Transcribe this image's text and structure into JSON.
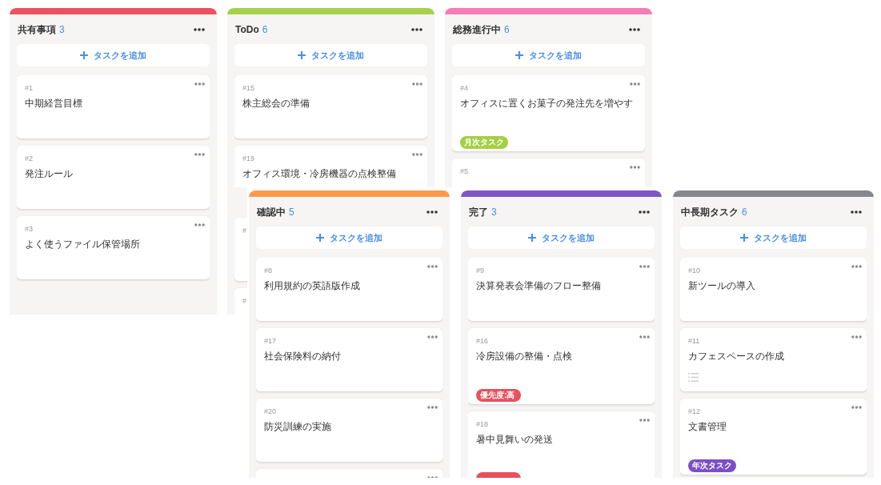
{
  "panels": [
    {
      "columns": [
        {
          "title": "共有事項",
          "count": "3",
          "color": "#ef4f5f",
          "add_label": "タスクを追加",
          "cards": [
            {
              "id": "#1",
              "title": "中期経営目標",
              "has_description": false,
              "menu": true
            },
            {
              "id": "#2",
              "title": "発注ルール",
              "has_description": false,
              "menu": true
            },
            {
              "id": "#3",
              "title": "よく使うファイル保管場所",
              "has_description": false,
              "menu": true
            }
          ]
        },
        {
          "title": "ToDo",
          "count": "6",
          "color": "#a6d24b",
          "add_label": "タスクを追加",
          "cards": [
            {
              "id": "#15",
              "title": "株主総会の準備",
              "has_description": false,
              "menu": true
            },
            {
              "id": "#19",
              "title": "オフィス環境・冷房機器の点検整備",
              "has_description": false,
              "menu": true
            },
            {
              "id": "#"
            },
            {
              "id": "#"
            }
          ]
        },
        {
          "title": "総務進行中",
          "count": "6",
          "color": "#f67cb4",
          "add_label": "タスクを追加",
          "cards": [
            {
              "id": "#4",
              "title": "オフィスに置くお菓子の発注先を増やす",
              "has_description": false,
              "menu": true,
              "tags": [
                {
                  "label": "月次タスク",
                  "color": "#a5cf45"
                }
              ]
            },
            {
              "id": "#5",
              "menu": true
            }
          ]
        }
      ]
    },
    {
      "columns": [
        {
          "title": "確認中",
          "count": "5",
          "color": "#ff9a4b",
          "add_label": "タスクを追加",
          "cards": [
            {
              "id": "#8",
              "title": "利用規約の英語版作成",
              "has_description": false,
              "menu": true
            },
            {
              "id": "#17",
              "title": "社会保険料の納付",
              "has_description": false,
              "menu": true
            },
            {
              "id": "#20",
              "title": "防災訓練の実施",
              "has_description": false,
              "menu": true
            },
            {
              "menu": true
            }
          ]
        },
        {
          "title": "完了",
          "count": "3",
          "color": "#7e57c4",
          "add_label": "タスクを追加",
          "cards": [
            {
              "id": "#9",
              "title": "決算発表会準備のフロー整備",
              "has_description": false,
              "menu": true
            },
            {
              "id": "#16",
              "title": "冷房設備の整備・点検",
              "has_description": false,
              "menu": true,
              "tags": [
                {
                  "label": "優先度:高",
                  "color": "#e9505c"
                }
              ]
            },
            {
              "id": "#18",
              "title": "暑中見舞いの発送",
              "has_description": false,
              "menu": true,
              "tags": [
                {
                  "color": "#e9505c"
                }
              ]
            }
          ]
        },
        {
          "title": "中長期タスク",
          "count": "6",
          "color": "#86868f",
          "add_label": "タスクを追加",
          "cards": [
            {
              "id": "#10",
              "title": "新ツールの導入",
              "has_description": false,
              "menu": true
            },
            {
              "id": "#11",
              "title": "カフェスペースの作成",
              "has_description": true,
              "menu": true
            },
            {
              "id": "#12",
              "title": "文書管理",
              "has_description": false,
              "menu": true,
              "tags": [
                {
                  "label": "年次タスク",
                  "color": "#7b4fc9"
                }
              ]
            }
          ]
        }
      ]
    }
  ]
}
